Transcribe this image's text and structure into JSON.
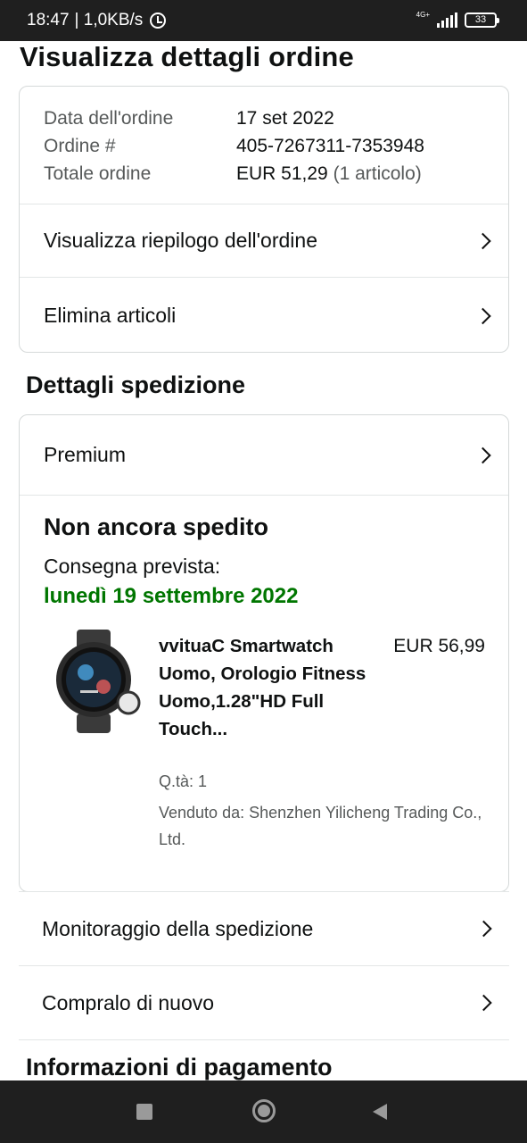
{
  "status_bar": {
    "time": "18:47",
    "speed": "| 1,0KB/s",
    "network": "4G+",
    "battery": "33"
  },
  "page": {
    "title": "Visualizza dettagli ordine"
  },
  "order_info": {
    "date_label": "Data dell'ordine",
    "date_value": "17 set 2022",
    "number_label": "Ordine #",
    "number_value": "405-7267311-7353948",
    "total_label": "Totale ordine",
    "total_value": "EUR 51,29",
    "total_items": "(1 articolo)"
  },
  "order_actions": {
    "summary": "Visualizza riepilogo dell'ordine",
    "remove": "Elimina articoli"
  },
  "shipping": {
    "section_title": "Dettagli spedizione",
    "method": "Premium",
    "status": "Non ancora spedito",
    "delivery_label": "Consegna prevista:",
    "delivery_date": "lunedì 19 settembre 2022"
  },
  "product": {
    "title": "vvituaC Smartwatch Uomo, Orologio Fitness Uomo,1.28\"HD Full Touch...",
    "price": "EUR 56,99",
    "qty": "Q.tà: 1",
    "seller": "Venduto da: Shenzhen Yilicheng Trading Co., Ltd.",
    "image_icon": "smartwatch-image"
  },
  "more_actions": {
    "track": "Monitoraggio della spedizione",
    "buy_again": "Compralo di nuovo"
  },
  "payment": {
    "section_title": "Informazioni di pagamento"
  },
  "colors": {
    "delivery_green": "#007600",
    "border": "#d5d9d9"
  }
}
